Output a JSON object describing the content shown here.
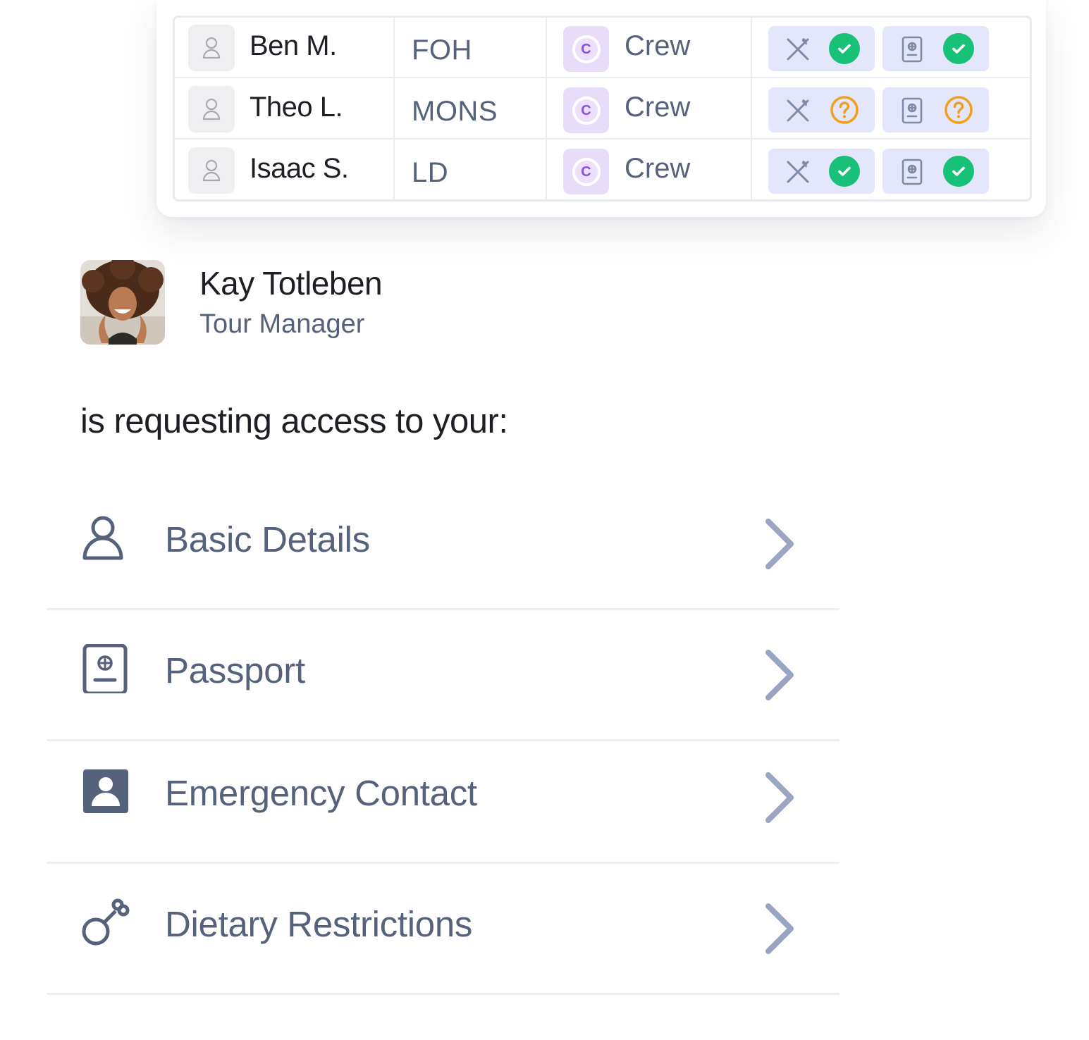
{
  "crew_table": {
    "rows": [
      {
        "name": "Ben M.",
        "department": "FOH",
        "role_initial": "C",
        "role": "Crew",
        "dietary_status": "approved",
        "passport_status": "approved"
      },
      {
        "name": "Theo L.",
        "department": "MONS",
        "role_initial": "C",
        "role": "Crew",
        "dietary_status": "pending",
        "passport_status": "pending"
      },
      {
        "name": "Isaac S.",
        "department": "LD",
        "role_initial": "C",
        "role": "Crew",
        "dietary_status": "approved",
        "passport_status": "approved"
      }
    ]
  },
  "requester": {
    "name": "Kay Totleben",
    "title": "Tour Manager"
  },
  "prompt": "is requesting access to your:",
  "access_items": [
    {
      "label": "Basic Details",
      "icon": "user-outline-icon"
    },
    {
      "label": "Passport",
      "icon": "passport-icon"
    },
    {
      "label": "Emergency Contact",
      "icon": "contact-card-icon"
    },
    {
      "label": "Dietary Restrictions",
      "icon": "drumstick-icon"
    }
  ],
  "colors": {
    "approved": "#17c178",
    "pending": "#f0a01c",
    "role_badge": "#8a4fe0",
    "label_text": "#56617c",
    "chevron": "#9aa4c3"
  }
}
